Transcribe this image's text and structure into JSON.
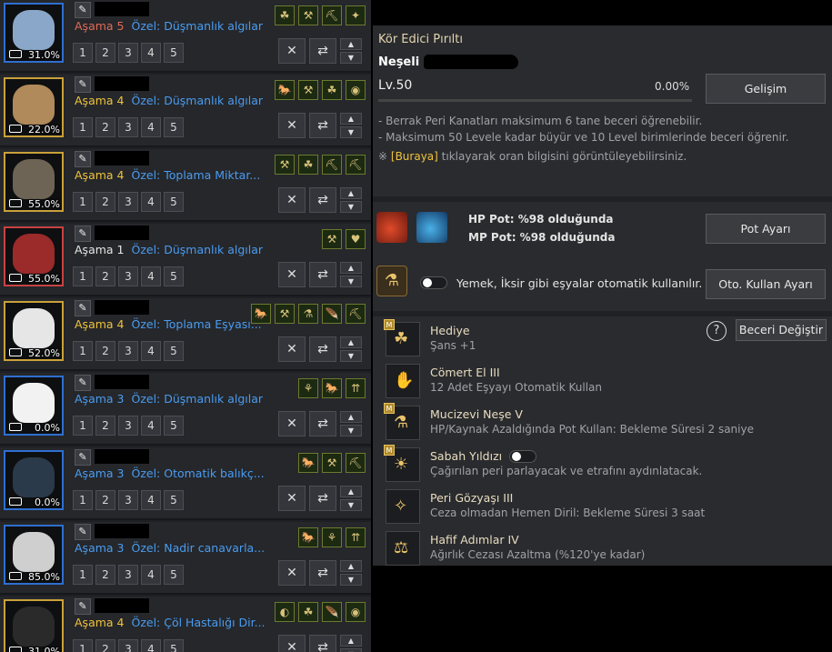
{
  "pets": [
    {
      "stage_label": "Aşama",
      "stage": "5",
      "stage_color": "red",
      "special": "Özel: Düşmanlık algılar",
      "pct": "31.0%",
      "frame": "blue",
      "art": "#8aa7c9",
      "icons": [
        "☘",
        "⚒",
        "⛏",
        "✦"
      ]
    },
    {
      "stage_label": "Aşama",
      "stage": "4",
      "stage_color": "gold",
      "special": "Özel: Düşmanlık algılar",
      "pct": "22.0%",
      "frame": "gold",
      "art": "#b08a5a",
      "icons": [
        "🐎",
        "⚒",
        "☘",
        "◉"
      ]
    },
    {
      "stage_label": "Aşama",
      "stage": "4",
      "stage_color": "gold",
      "special": "Özel: Toplama Miktar...",
      "pct": "55.0%",
      "frame": "gold",
      "art": "#6e6455",
      "icons": [
        "⚒",
        "☘",
        "⛏",
        "⛏"
      ]
    },
    {
      "stage_label": "Aşama",
      "stage": "1",
      "stage_color": "white",
      "special": "Özel: Düşmanlık algılar",
      "pct": "55.0%",
      "frame": "rare",
      "art": "#9b2a2a",
      "icons": [
        "⚒",
        "♥"
      ]
    },
    {
      "stage_label": "Aşama",
      "stage": "4",
      "stage_color": "gold",
      "special": "Özel: Toplama Eşyası...",
      "pct": "52.0%",
      "frame": "gold",
      "art": "#e6e6e6",
      "icons": [
        "🐎",
        "⚒",
        "⚗",
        "🪶",
        "⛏"
      ]
    },
    {
      "stage_label": "Aşama",
      "stage": "3",
      "stage_color": "blue",
      "special": "Özel: Düşmanlık algılar",
      "pct": "0.0%",
      "frame": "blue",
      "art": "#f2f2f2",
      "icons": [
        "⚘",
        "🐎",
        "⇈"
      ]
    },
    {
      "stage_label": "Aşama",
      "stage": "3",
      "stage_color": "blue",
      "special": "Özel: Otomatik balıkç...",
      "pct": "0.0%",
      "frame": "blue",
      "art": "#2a3a4a",
      "icons": [
        "🐎",
        "⚒",
        "⛏"
      ]
    },
    {
      "stage_label": "Aşama",
      "stage": "3",
      "stage_color": "blue",
      "special": "Özel: Nadir canavarla...",
      "pct": "85.0%",
      "frame": "blue",
      "art": "#cfcfcf",
      "icons": [
        "🐎",
        "⚘",
        "⇈"
      ]
    },
    {
      "stage_label": "Aşama",
      "stage": "4",
      "stage_color": "gold",
      "special": "Özel: Çöl Hastalığı Dir...",
      "pct": "31.0%",
      "frame": "gold",
      "art": "#2a2a2a",
      "icons": [
        "◐",
        "☘",
        "🪶",
        "◉"
      ]
    }
  ],
  "slots": [
    "1",
    "2",
    "3",
    "4",
    "5"
  ],
  "detail": {
    "name": "Kör Edici Pırıltı",
    "sub_visible": "Neşeli",
    "level": "Lv.50",
    "level_pct": "0.00%",
    "level_fill": 0.0,
    "develop_btn": "Gelişim",
    "note1": "- Berrak Peri Kanatları maksimum 6 tane beceri öğrenebilir.",
    "note2": "- Maksimum 50 Levele kadar büyür ve 10 Level birimlerinde beceri öğrenir.",
    "note3_pre": "※",
    "note3_link": "[Buraya]",
    "note3_post": "tıklayarak oran bilgisini görüntüleyebilirsiniz.",
    "hp_pot": "HP Pot: %98 olduğunda",
    "mp_pot": "MP Pot: %98 olduğunda",
    "pot_btn": "Pot Ayarı",
    "auto_text": "Yemek, İksir gibi eşyalar otomatik kullanılır.",
    "auto_btn": "Oto. Kullan Ayarı",
    "help": "?",
    "skill_change_btn": "Beceri Değiştir",
    "m_badge": "M",
    "skills": [
      {
        "title": "Hediye",
        "desc": "Şans +1",
        "glyph": "☘",
        "m": true
      },
      {
        "title": "Cömert El III",
        "desc": "12 Adet Eşyayı Otomatik Kullan",
        "glyph": "✋",
        "m": false
      },
      {
        "title": "Mucizevi Neşe V",
        "desc": "HP/Kaynak Azaldığında Pot Kullan: Bekleme Süresi 2 saniye",
        "glyph": "⚗",
        "m": true
      },
      {
        "title": "Sabah Yıldızı",
        "desc": "Çağırılan peri parlayacak ve etrafını aydınlatacak.",
        "glyph": "☀",
        "m": true
      },
      {
        "title": "Peri Gözyaşı III",
        "desc": "Ceza olmadan Hemen Diril: Bekleme Süresi 3 saat",
        "glyph": "✧",
        "m": false
      },
      {
        "title": "Hafif Adımlar IV",
        "desc": "Ağırlık Cezası Azaltma (%120'ye kadar)",
        "glyph": "⚖",
        "m": false
      }
    ]
  }
}
